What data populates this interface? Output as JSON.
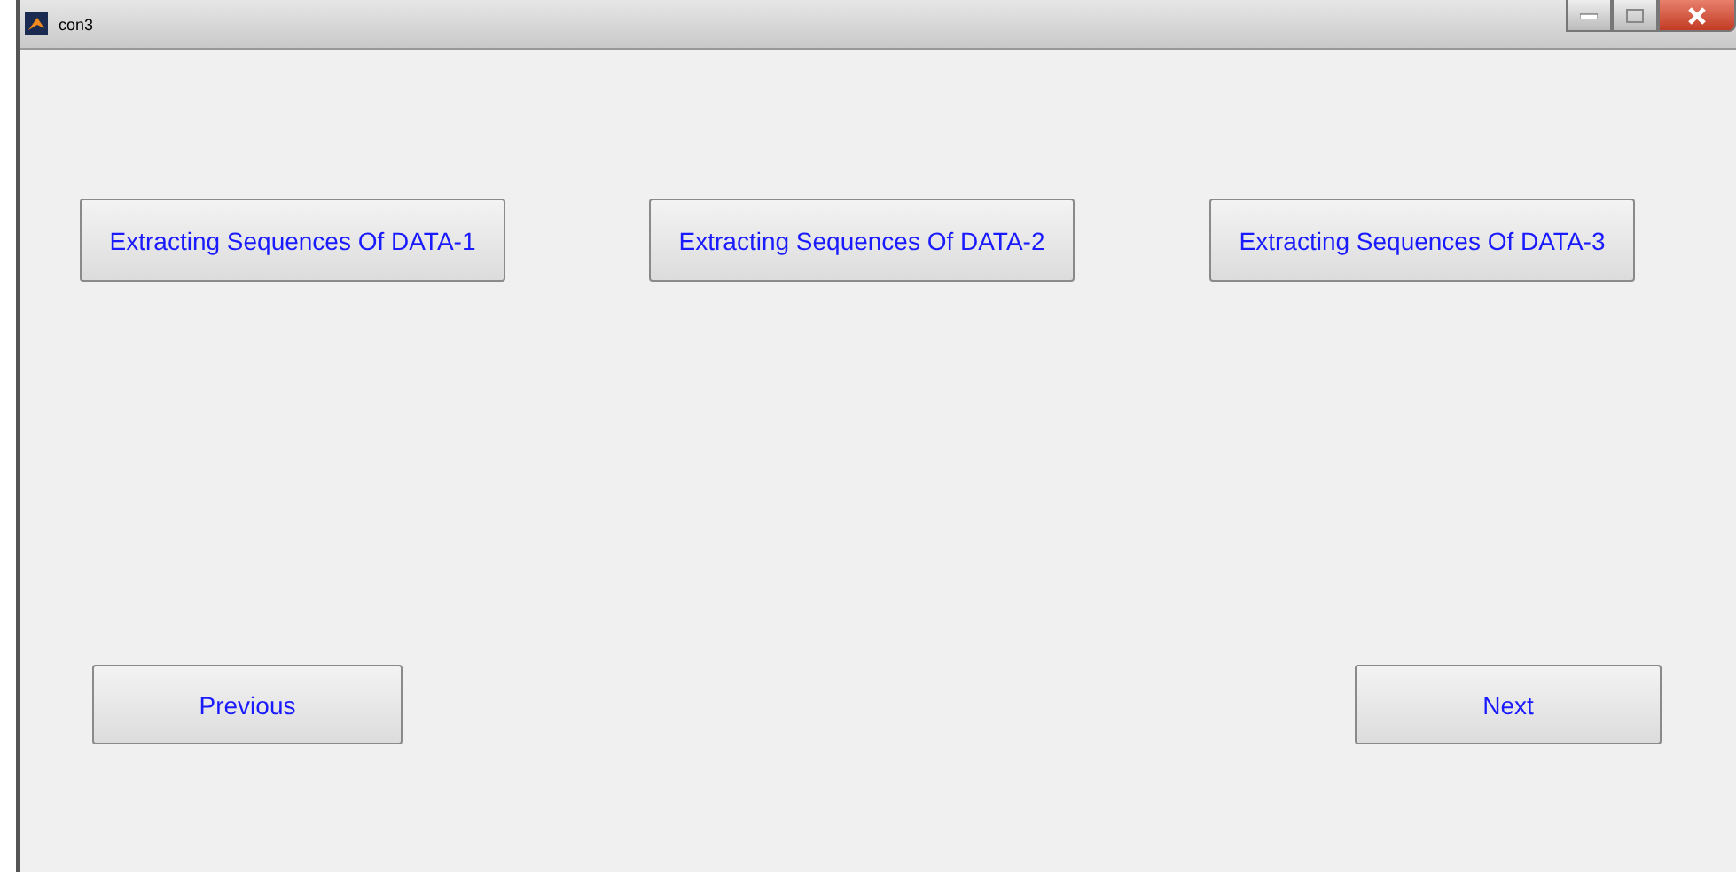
{
  "window": {
    "title": "con3"
  },
  "top_buttons": [
    "Extracting Sequences Of DATA-1",
    "Extracting Sequences Of DATA-2",
    "Extracting Sequences Of DATA-3"
  ],
  "nav_buttons": {
    "previous": "Previous",
    "next": "Next"
  }
}
